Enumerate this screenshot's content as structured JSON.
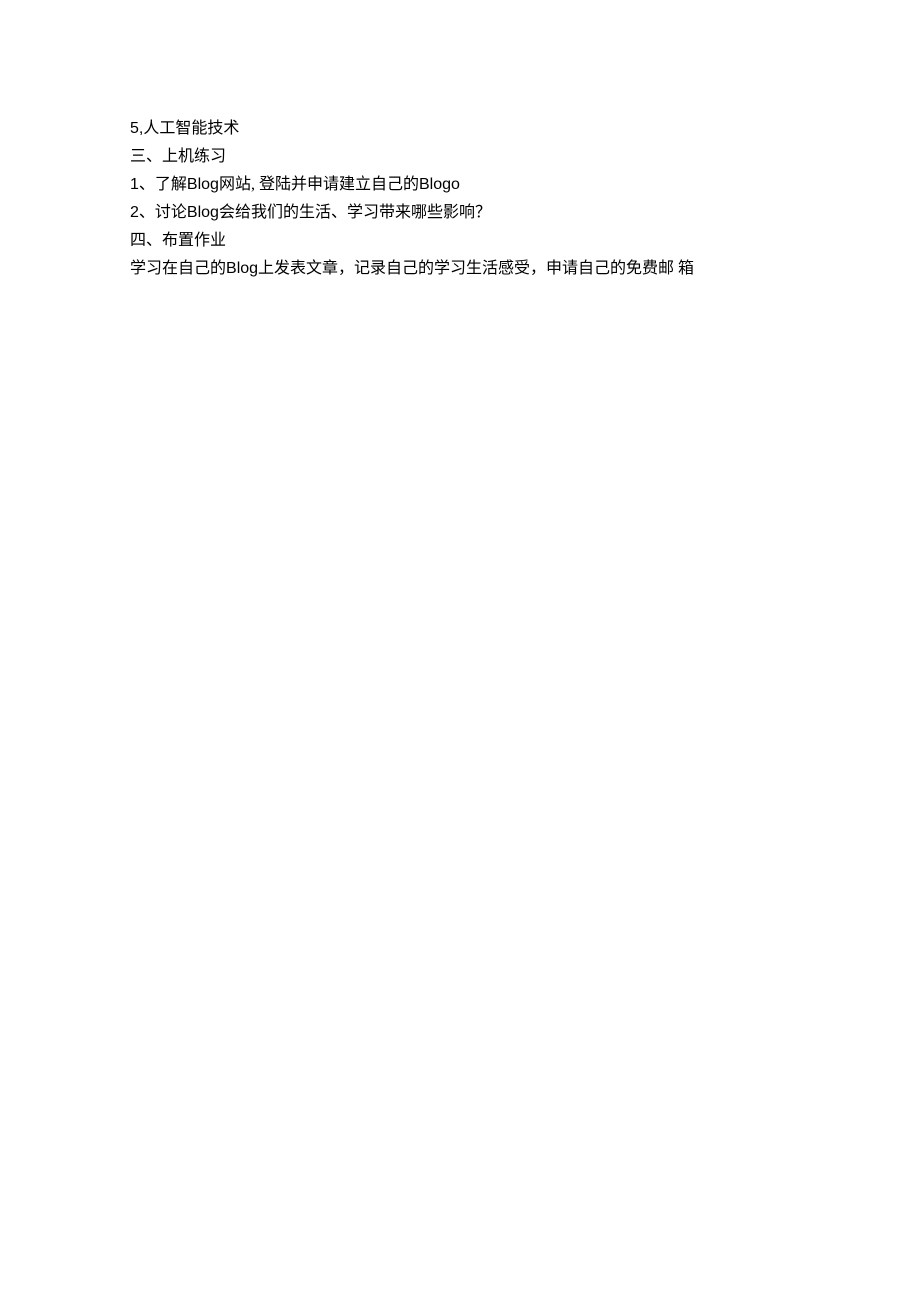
{
  "lines": {
    "l1_a": "5,",
    "l1_b": "人工智能技术",
    "l2": "三、上机练习",
    "l3_a": "1",
    "l3_b": "、了解",
    "l3_c": "Blog",
    "l3_d": "网站, 登陆并申请建立自己的",
    "l3_e": "Blogo",
    "l4_a": "2",
    "l4_b": "、讨论",
    "l4_c": "Blog",
    "l4_d": "会给我们的生活、学习带来哪些影响？",
    "l5": "四、布置作业",
    "l6_a": "学习在自己的",
    "l6_b": "Blog",
    "l6_c": "上发表文章，记录自己的学习生活感受，申请自己的免费邮  箱"
  }
}
